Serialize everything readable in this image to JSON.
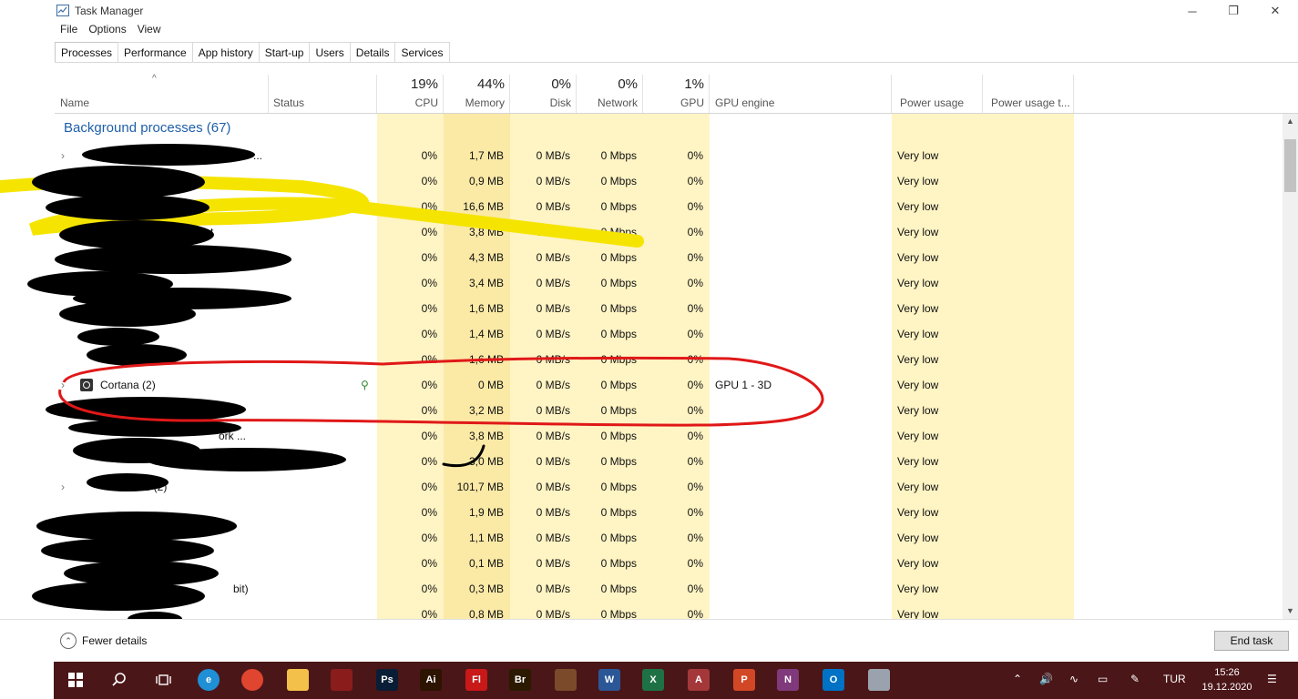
{
  "window": {
    "title": "Task Manager",
    "minimize_glyph": "─",
    "maximize_glyph": "❐",
    "close_glyph": "✕"
  },
  "menu": [
    "File",
    "Options",
    "View"
  ],
  "tabs": [
    "Processes",
    "Performance",
    "App history",
    "Start-up",
    "Users",
    "Details",
    "Services"
  ],
  "active_tab": "Processes",
  "columns": {
    "name": "Name",
    "status": "Status",
    "cpu": {
      "pct": "19%",
      "label": "CPU"
    },
    "memory": {
      "pct": "44%",
      "label": "Memory"
    },
    "disk": {
      "pct": "0%",
      "label": "Disk"
    },
    "network": {
      "pct": "0%",
      "label": "Network"
    },
    "gpu": {
      "pct": "1%",
      "label": "GPU"
    },
    "gpu_engine": "GPU engine",
    "power": "Power usage",
    "power_trend": "Power usage t..."
  },
  "group_title": "Background processes (67)",
  "rows": [
    {
      "name": "...",
      "cpu": "0%",
      "memory": "1,7 MB",
      "disk": "0 MB/s",
      "network": "0 Mbps",
      "gpu": "0%",
      "engine": "",
      "power": "Very low"
    },
    {
      "name": "",
      "cpu": "0%",
      "memory": "0,9 MB",
      "disk": "0 MB/s",
      "network": "0 Mbps",
      "gpu": "0%",
      "engine": "",
      "power": "Very low"
    },
    {
      "name": "",
      "cpu": "0%",
      "memory": "16,6 MB",
      "disk": "0 MB/s",
      "network": "0 Mbps",
      "gpu": "0%",
      "engine": "",
      "power": "Very low"
    },
    {
      "name": "st",
      "cpu": "0%",
      "memory": "3,8 MB",
      "disk": "0 MB/s",
      "network": "0 Mbps",
      "gpu": "0%",
      "engine": "",
      "power": "Very low"
    },
    {
      "name": "",
      "cpu": "0%",
      "memory": "4,3 MB",
      "disk": "0 MB/s",
      "network": "0 Mbps",
      "gpu": "0%",
      "engine": "",
      "power": "Very low"
    },
    {
      "name": "",
      "cpu": "0%",
      "memory": "3,4 MB",
      "disk": "0 MB/s",
      "network": "0 Mbps",
      "gpu": "0%",
      "engine": "",
      "power": "Very low"
    },
    {
      "name": "",
      "cpu": "0%",
      "memory": "1,6 MB",
      "disk": "0 MB/s",
      "network": "0 Mbps",
      "gpu": "0%",
      "engine": "",
      "power": "Very low"
    },
    {
      "name": "",
      "cpu": "0%",
      "memory": "1,4 MB",
      "disk": "0 MB/s",
      "network": "0 Mbps",
      "gpu": "0%",
      "engine": "",
      "power": "Very low"
    },
    {
      "name": "",
      "cpu": "0%",
      "memory": "1,6 MB",
      "disk": "0 MB/s",
      "network": "0 Mbps",
      "gpu": "0%",
      "engine": "",
      "power": "Very low"
    },
    {
      "name": "Cortana (2)",
      "cpu": "0%",
      "memory": "0 MB",
      "disk": "0 MB/s",
      "network": "0 Mbps",
      "gpu": "0%",
      "engine": "GPU 1 - 3D",
      "power": "Very low"
    },
    {
      "name": "",
      "cpu": "0%",
      "memory": "3,2 MB",
      "disk": "0 MB/s",
      "network": "0 Mbps",
      "gpu": "0%",
      "engine": "",
      "power": "Very low"
    },
    {
      "name": "ork ...",
      "cpu": "0%",
      "memory": "3,8 MB",
      "disk": "0 MB/s",
      "network": "0 Mbps",
      "gpu": "0%",
      "engine": "",
      "power": "Very low"
    },
    {
      "name": "",
      "cpu": "0%",
      "memory": "3,0 MB",
      "disk": "0 MB/s",
      "network": "0 Mbps",
      "gpu": "0%",
      "engine": "",
      "power": "Very low"
    },
    {
      "name": "ice (2)",
      "cpu": "0%",
      "memory": "101,7 MB",
      "disk": "0 MB/s",
      "network": "0 Mbps",
      "gpu": "0%",
      "engine": "",
      "power": "Very low"
    },
    {
      "name": "",
      "cpu": "0%",
      "memory": "1,9 MB",
      "disk": "0 MB/s",
      "network": "0 Mbps",
      "gpu": "0%",
      "engine": "",
      "power": "Very low"
    },
    {
      "name": "",
      "cpu": "0%",
      "memory": "1,1 MB",
      "disk": "0 MB/s",
      "network": "0 Mbps",
      "gpu": "0%",
      "engine": "",
      "power": "Very low"
    },
    {
      "name": "",
      "cpu": "0%",
      "memory": "0,1 MB",
      "disk": "0 MB/s",
      "network": "0 Mbps",
      "gpu": "0%",
      "engine": "",
      "power": "Very low"
    },
    {
      "name": "bit)",
      "cpu": "0%",
      "memory": "0,3 MB",
      "disk": "0 MB/s",
      "network": "0 Mbps",
      "gpu": "0%",
      "engine": "",
      "power": "Very low"
    },
    {
      "name": "",
      "cpu": "0%",
      "memory": "0,8 MB",
      "disk": "0 MB/s",
      "network": "0 Mbps",
      "gpu": "0%",
      "engine": "",
      "power": "Very low"
    }
  ],
  "footer": {
    "fewer_details": "Fewer details",
    "end_task": "End task"
  },
  "taskbar": {
    "apps": [
      {
        "icon": "edge-icon",
        "text": "e",
        "color": "#1f8fd6"
      },
      {
        "icon": "chrome-icon",
        "text": "",
        "color": "#e0452f"
      },
      {
        "icon": "file-explorer-icon",
        "text": "",
        "color": "#f3c14a"
      },
      {
        "icon": "app-icon",
        "text": "",
        "color": "#8a1c1c"
      },
      {
        "icon": "photoshop-icon",
        "text": "Ps",
        "color": "#0a1d36"
      },
      {
        "icon": "illustrator-icon",
        "text": "Ai",
        "color": "#2c1400"
      },
      {
        "icon": "flash-icon",
        "text": "Fl",
        "color": "#c81818"
      },
      {
        "icon": "bridge-icon",
        "text": "Br",
        "color": "#2b1a00"
      },
      {
        "icon": "pencil-icon",
        "text": "",
        "color": "#7a4a2a"
      },
      {
        "icon": "word-icon",
        "text": "W",
        "color": "#2b5797"
      },
      {
        "icon": "excel-icon",
        "text": "X",
        "color": "#1e7145"
      },
      {
        "icon": "access-icon",
        "text": "A",
        "color": "#a4373a"
      },
      {
        "icon": "powerpoint-icon",
        "text": "P",
        "color": "#d24726"
      },
      {
        "icon": "onenote-icon",
        "text": "N",
        "color": "#80397b"
      },
      {
        "icon": "outlook-icon",
        "text": "O",
        "color": "#0072c6"
      },
      {
        "icon": "task-manager-icon",
        "text": "",
        "color": "#9aa3ad"
      }
    ],
    "lang": "TUR",
    "time": "15:26",
    "date": "19.12.2020"
  }
}
